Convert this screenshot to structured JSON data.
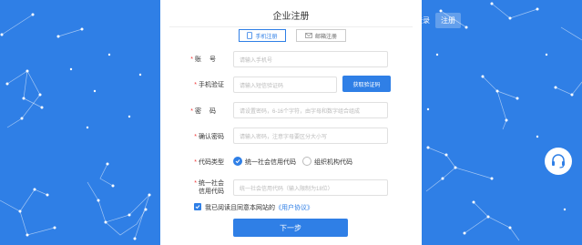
{
  "header": {
    "login_label": "登录",
    "register_label": "注册"
  },
  "form": {
    "title": "企业注册",
    "tabs": [
      {
        "label": "手机注册",
        "icon": "phone-icon",
        "active": true
      },
      {
        "label": "邮箱注册",
        "icon": "mail-icon",
        "active": false
      }
    ],
    "account": {
      "label": "账号",
      "placeholder": "请输入手机号"
    },
    "sms_code": {
      "label": "手机验证",
      "placeholder": "请输入短信验证码",
      "button": "获取验证码"
    },
    "password": {
      "label": "密码",
      "placeholder": "请设置密码，6-16个字符，由字母和数字组合组成"
    },
    "confirm_password": {
      "label": "确认密码",
      "placeholder": "请输入密码，注意字母要区分大小写"
    },
    "code_type": {
      "label": "代码类型",
      "options": [
        {
          "label": "统一社会信用代码",
          "selected": true
        },
        {
          "label": "组织机构代码",
          "selected": false
        }
      ]
    },
    "credit_code": {
      "label_line1": "统一社会",
      "label_line2": "信用代码",
      "placeholder": "统一社会信用代码（输入限制为18位）"
    },
    "agreement": {
      "checked": true,
      "text": "我已阅读且同意本网站的",
      "link": "《用户协议》"
    },
    "submit_label": "下一步"
  },
  "support": {
    "icon": "headset-icon"
  },
  "colors": {
    "accent": "#2f7fe6",
    "background": "#2f7fe6",
    "required": "#e33333"
  }
}
